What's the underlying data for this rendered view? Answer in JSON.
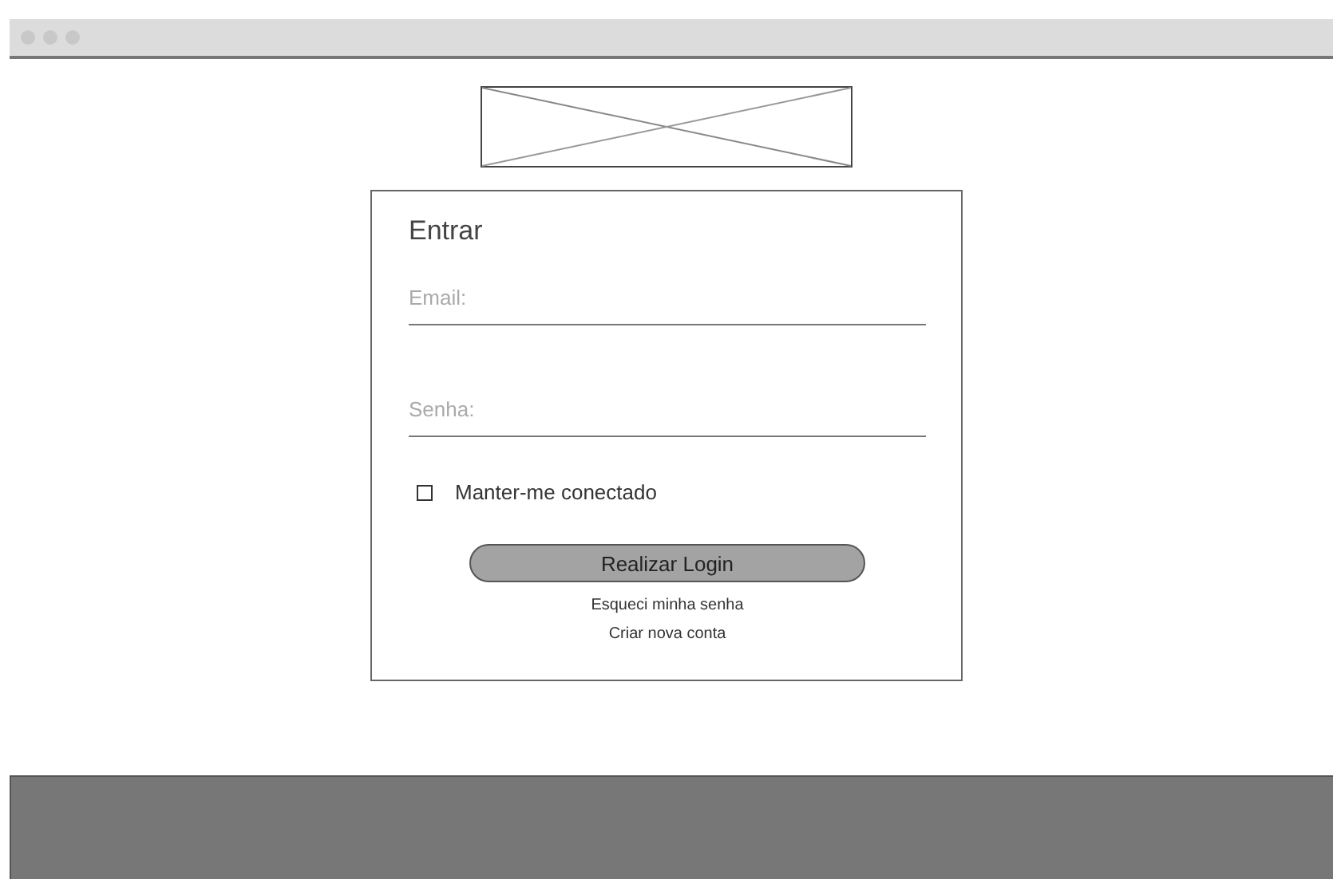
{
  "login": {
    "title": "Entrar",
    "fields": [
      {
        "placeholder": "Email:"
      },
      {
        "placeholder": "Senha:"
      }
    ],
    "remember": {
      "label": "Manter-me conectado",
      "checked": false
    },
    "button": "Realizar Login",
    "links": [
      "Esqueci minha senha",
      "Criar nova conta"
    ]
  }
}
